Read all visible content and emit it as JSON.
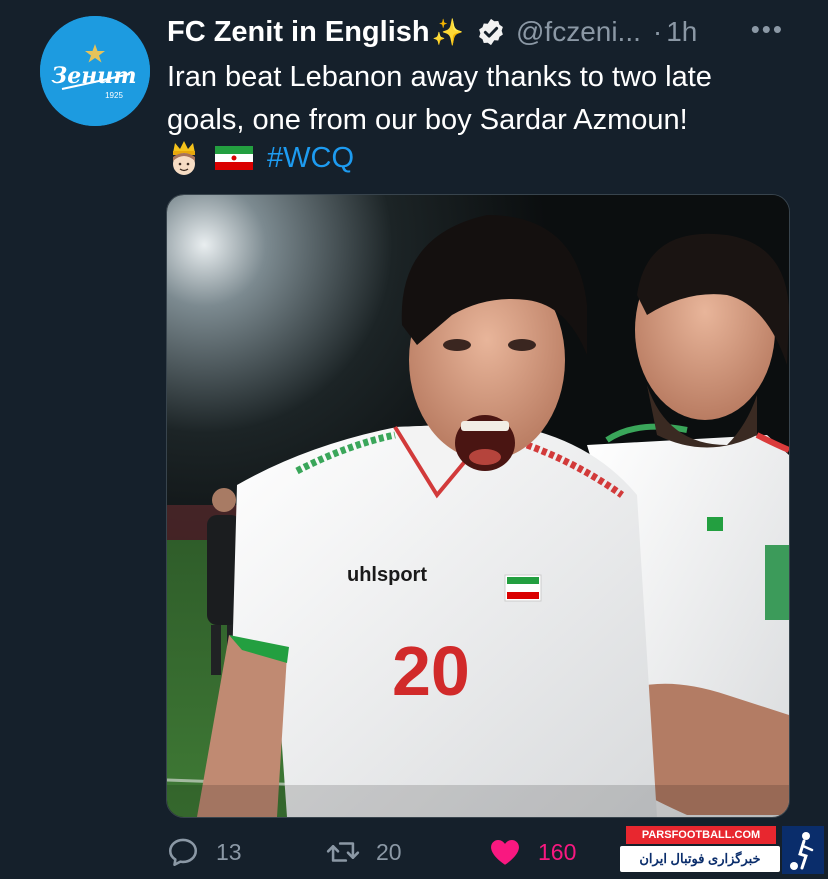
{
  "tweet": {
    "display_name": "FC Zenit in English",
    "name_emoji": "✨",
    "handle": "@fczeni...",
    "separator": "·",
    "time": "1h",
    "more_label": "•••",
    "text": "Iran beat Lebanon away thanks to two late goals, one from our boy Sardar Azmoun!",
    "hashtag": "#WCQ",
    "emojis": [
      "prince-emoji",
      "iran-flag-emoji"
    ]
  },
  "avatar": {
    "logo_text": "Зенит",
    "logo_year": "1925",
    "background": "#1d9be0"
  },
  "media": {
    "jersey_brand": "uhlsport",
    "jersey_number": "20"
  },
  "actions": {
    "reply_count": "13",
    "retweet_count": "20",
    "like_count": "160"
  },
  "watermark": {
    "site": "PARSFOOTBALL.COM",
    "tagline": "خبرگزاری فوتبال ایران"
  },
  "colors": {
    "background": "#15202b",
    "text": "#ffffff",
    "secondary": "#8b98a5",
    "link": "#1d9bf0",
    "like": "#f91880"
  }
}
